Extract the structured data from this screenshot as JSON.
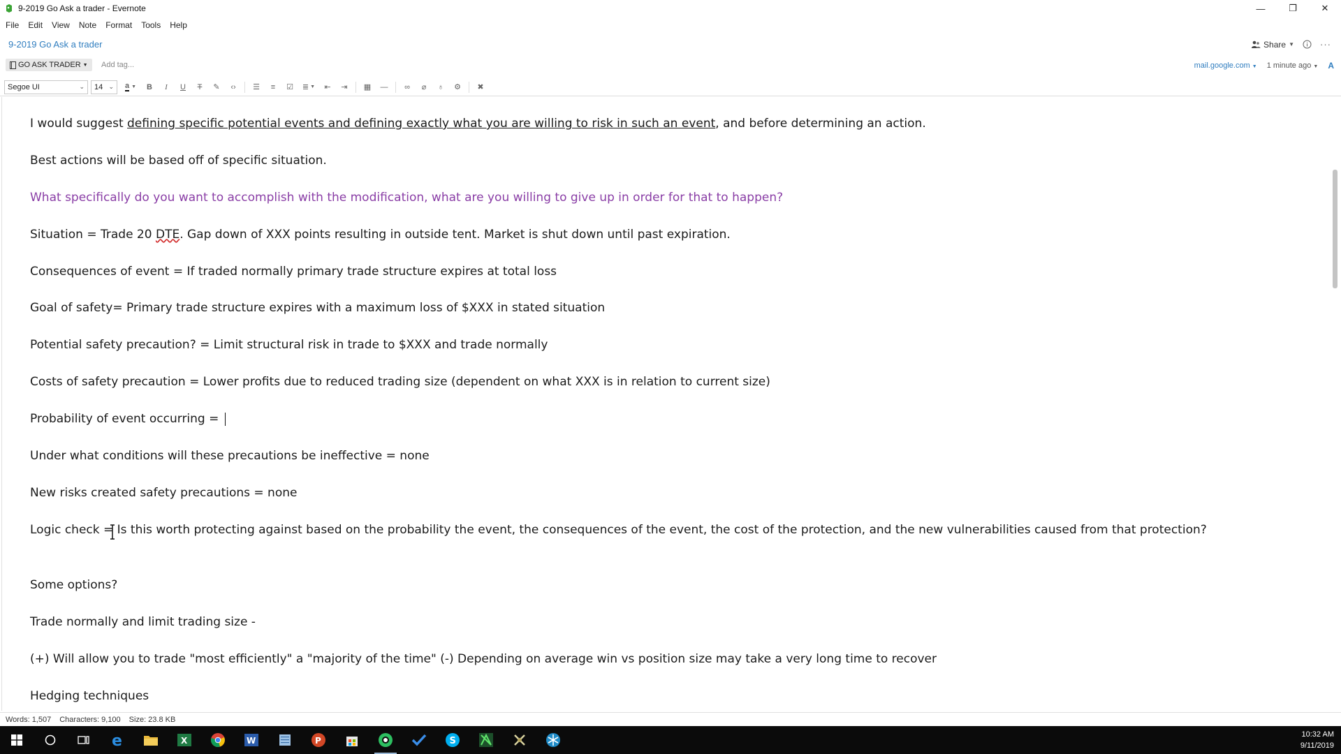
{
  "window": {
    "title": "9-2019 Go Ask a trader - Evernote",
    "controls": {
      "minimize": "—",
      "restore": "❐",
      "close": "✕"
    }
  },
  "menu": [
    "File",
    "Edit",
    "View",
    "Note",
    "Format",
    "Tools",
    "Help"
  ],
  "note": {
    "title": "9-2019 Go Ask a trader",
    "notebook": "GO ASK TRADER",
    "add_tag_placeholder": "Add tag...",
    "share_label": "Share",
    "source": "mail.google.com",
    "updated": "1 minute ago"
  },
  "toolbar": {
    "font_family": "Segoe UI",
    "font_size": "14"
  },
  "content": {
    "l1_before": "I would suggest ",
    "l1_link": "defining specific potential events and defining exactly what you are willing to risk in such an event",
    "l1_after": ", and before determining an action.",
    "l2": "Best actions will be based off of specific situation.",
    "l3": "What specifically do you want to accomplish with the modification, what are you willing to give up in order for that to happen?",
    "l4_before": "Situation = Trade 20 ",
    "l4_dte": "DTE",
    "l4_after": ". Gap down of XXX points resulting in outside tent. Market is shut down until past expiration.",
    "l5": "Consequences of event = If traded normally primary trade structure expires at total loss",
    "l6": "Goal of safety= Primary trade structure expires with a maximum loss of $XXX in stated situation",
    "l7": "Potential safety precaution? = Limit structural risk in trade to $XXX and trade normally",
    "l8": "Costs of safety precaution = Lower profits due to reduced trading size (dependent on what XXX is in relation to current size)",
    "l9": "Probability of event occurring = ",
    "l10": "Under what conditions will these precautions be ineffective = none",
    "l11": "New risks created safety precautions = none",
    "l12": "Logic check = Is this worth protecting against based on the probability the event, the consequences of the event, the cost of the protection, and the new vulnerabilities caused from that protection?",
    "l13": "Some options?",
    "l14": "Trade normally and limit trading size -",
    "l15": "(+) Will allow you to trade \"most efficiently\" a \"majority of the time\"  (-) Depending on average win vs position size may take a very long time to recover",
    "l16": "Hedging techniques"
  },
  "status": {
    "words": "Words: 1,507",
    "characters": "Characters: 9,100",
    "size": "Size: 23.8 KB"
  },
  "taskbar": {
    "time": "10:32 AM",
    "date": "9/11/2019",
    "apps": [
      "start-icon",
      "cortana-icon",
      "task-view-icon",
      "edge-icon",
      "file-explorer-icon",
      "excel-icon",
      "chrome-icon",
      "word-icon",
      "notepad-icon",
      "powerpoint-icon",
      "store-icon",
      "evernote-icon",
      "todo-icon",
      "skype-icon",
      "green-app-icon",
      "tool-app-icon",
      "snowflake-app-icon"
    ]
  },
  "colors": {
    "accent": "#2f7dbf",
    "question_text": "#8a3ea6",
    "taskbar": "#0b0b0b"
  }
}
